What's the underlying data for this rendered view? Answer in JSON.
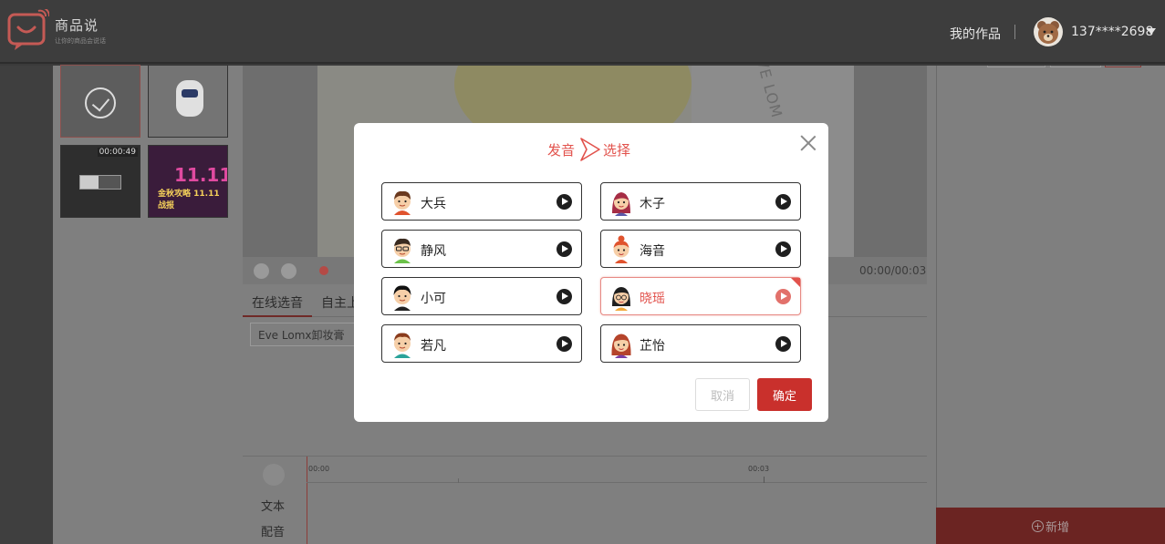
{
  "header": {
    "logo_title": "商品说",
    "logo_sub": "让你的商品会说话",
    "my_works": "我的作品",
    "username": "137****2698"
  },
  "thumbnails": {
    "t3_time": "00:00:49",
    "t4_text": "金秋攻略 11.11战报",
    "t4_big": "11.11"
  },
  "video": {
    "watermark": "EVE LOM",
    "time": "00:00/00:03"
  },
  "editor": {
    "tab_online": "在线选音",
    "tab_custom": "自主上",
    "name_value": "Eve Lomx卸妆膏"
  },
  "timeline": {
    "text_label": "文本",
    "audio_label": "配音",
    "t0": "00:00",
    "t3": "00:03"
  },
  "right_panel": {
    "add_label": "新增"
  },
  "modal": {
    "title_left": "发音",
    "title_right": "选择",
    "voices": [
      {
        "name": "大兵",
        "selected": false
      },
      {
        "name": "木子",
        "selected": false
      },
      {
        "name": "静风",
        "selected": false
      },
      {
        "name": "海音",
        "selected": false
      },
      {
        "name": "小可",
        "selected": false
      },
      {
        "name": "晓瑶",
        "selected": true
      },
      {
        "name": "若凡",
        "selected": false
      },
      {
        "name": "芷怡",
        "selected": false
      }
    ],
    "cancel_label": "取消",
    "ok_label": "确定"
  },
  "colors": {
    "accent": "#e2524c",
    "ok_button": "#c9302c",
    "overlay_bg": "#3d3d3d"
  }
}
